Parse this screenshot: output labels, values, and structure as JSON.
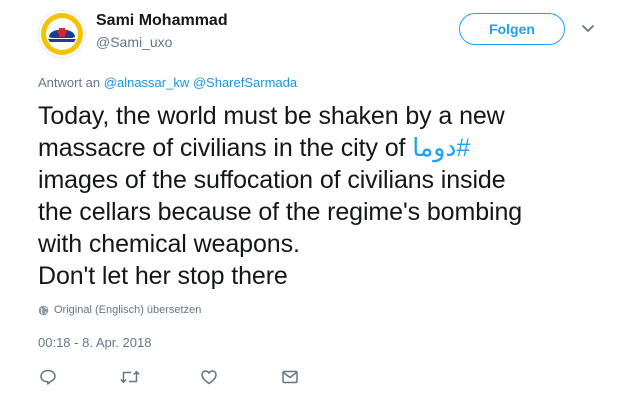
{
  "author": {
    "name": "Sami Mohammad",
    "handle": "@Sami_uxo",
    "avatar_icon": "white-helmets-logo-icon"
  },
  "follow_button_label": "Folgen",
  "reply_to": {
    "prefix": "Antwort an",
    "mentions": [
      "@alnassar_kw",
      "@SharefSarmada"
    ]
  },
  "tweet": {
    "line1": "Today, the world must be shaken by a new",
    "line2_text": "massacre of civilians in the city of ",
    "hashtag": "#دوما",
    "line3": "images of the suffocation of civilians inside",
    "line4": "the cellars because of the regime's bombing",
    "line5": "with chemical weapons.",
    "line6": "Don't let her stop there"
  },
  "translate_label": "Original (Englisch) übersetzen",
  "timestamp": "00:18 - 8. Apr. 2018",
  "actions": [
    "reply-icon",
    "retweet-icon",
    "like-icon",
    "direct-message-icon"
  ],
  "colors": {
    "accent": "#1da1f2",
    "secondary_text": "#657786",
    "logo_yellow": "#f3c300",
    "logo_blue": "#1f3d8c",
    "logo_red": "#d8262a"
  }
}
